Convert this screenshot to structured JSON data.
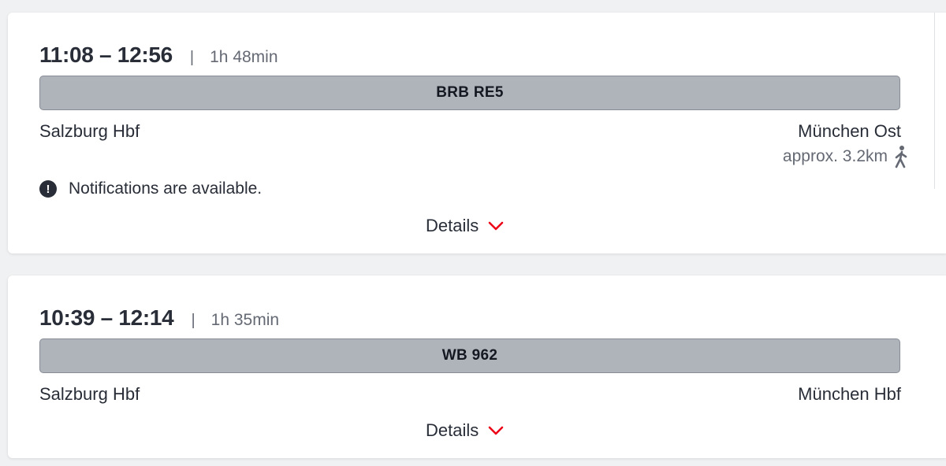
{
  "connections": [
    {
      "time_range": "11:08 – 12:56",
      "separator": "|",
      "duration": "1h 48min",
      "train": "BRB RE5",
      "from": "Salzburg Hbf",
      "to": "München Ost",
      "walk_distance": "approx. 3.2km",
      "walk_icon": "walking-person-icon",
      "notice": "Notifications are available.",
      "notice_icon": "!",
      "details_label": "Details"
    },
    {
      "time_range": "10:39 – 12:14",
      "separator": "|",
      "duration": "1h 35min",
      "train": "WB 962",
      "from": "Salzburg Hbf",
      "to": "München Hbf",
      "details_label": "Details"
    }
  ],
  "colors": {
    "accent": "#ec0016",
    "train_bar": "#afb4bb",
    "text": "#282d37",
    "muted": "#646973"
  }
}
